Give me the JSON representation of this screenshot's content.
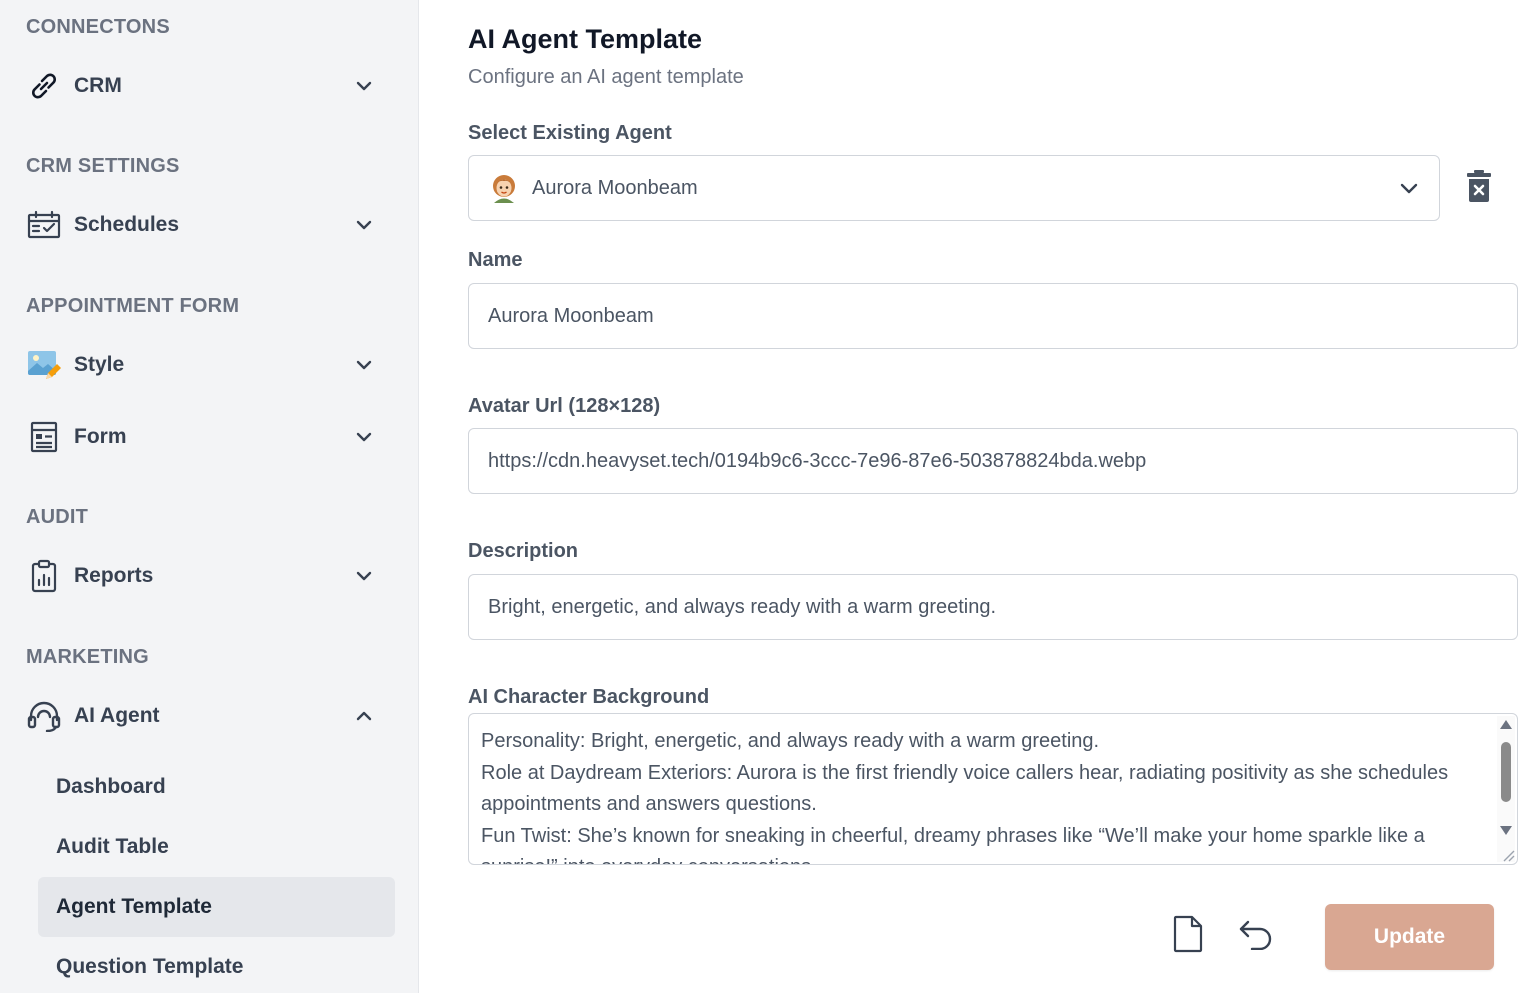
{
  "sidebar": {
    "sections": [
      {
        "title": "CONNECTONS"
      },
      {
        "title": "CRM SETTINGS"
      },
      {
        "title": "APPOINTMENT FORM"
      },
      {
        "title": "AUDIT"
      },
      {
        "title": "MARKETING"
      }
    ],
    "items": [
      {
        "label": "CRM",
        "icon": "link-icon",
        "expanded": false
      },
      {
        "label": "Schedules",
        "icon": "calendar-check-icon",
        "expanded": false
      },
      {
        "label": "Style",
        "icon": "image-edit-icon",
        "expanded": false
      },
      {
        "label": "Form",
        "icon": "form-icon",
        "expanded": false
      },
      {
        "label": "Reports",
        "icon": "clipboard-chart-icon",
        "expanded": false
      },
      {
        "label": "AI Agent",
        "icon": "headset-icon",
        "expanded": true
      }
    ],
    "sub_items": [
      {
        "label": "Dashboard",
        "active": false
      },
      {
        "label": "Audit Table",
        "active": false
      },
      {
        "label": "Agent Template",
        "active": true
      },
      {
        "label": "Question Template",
        "active": false
      }
    ]
  },
  "main": {
    "title": "AI Agent Template",
    "subtitle": "Configure an AI agent template",
    "select_agent": {
      "label": "Select Existing Agent",
      "value": "Aurora Moonbeam"
    },
    "name": {
      "label": "Name",
      "value": "Aurora Moonbeam"
    },
    "avatar_url": {
      "label": "Avatar Url (128×128)",
      "value": "https://cdn.heavyset.tech/0194b9c6-3ccc-7e96-87e6-503878824bda.webp"
    },
    "description": {
      "label": "Description",
      "value": "Bright, energetic, and always ready with a warm greeting."
    },
    "background": {
      "label": "AI Character Background",
      "value": "Personality: Bright, energetic, and always ready with a warm greeting.\nRole at Daydream Exteriors: Aurora is the first friendly voice callers hear, radiating positivity as she schedules appointments and answers questions.\nFun Twist: She’s known for sneaking in cheerful, dreamy phrases like “We’ll make your home sparkle like a sunrise!” into everyday conversations."
    },
    "actions": {
      "update_label": "Update",
      "update_color": "#d9a792"
    }
  }
}
